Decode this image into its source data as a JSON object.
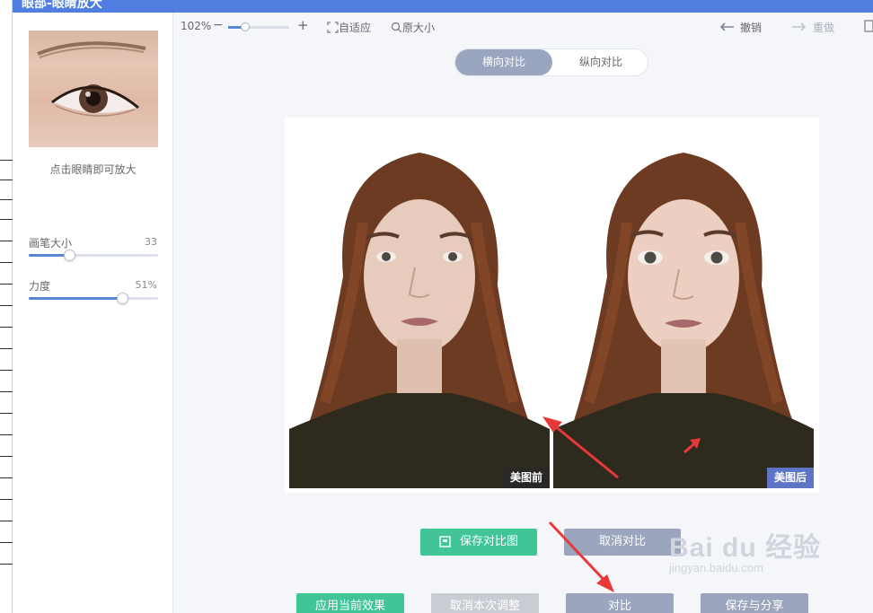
{
  "window": {
    "title": "眼部-眼睛放大"
  },
  "left_panel": {
    "hint": "点击眼睛即可放大",
    "sliders": [
      {
        "label": "画笔大小",
        "value_text": "33",
        "fraction": 0.31
      },
      {
        "label": "力度",
        "value_text": "51%",
        "fraction": 0.72
      }
    ]
  },
  "toolbar": {
    "zoom": "102%",
    "zoom_out": "−",
    "zoom_in": "+",
    "fit": "自适应",
    "original": "原大小",
    "undo": "撤销",
    "redo": "重做"
  },
  "compare_mode": {
    "options": [
      "横向对比",
      "纵向对比"
    ],
    "active": "横向对比"
  },
  "photos": {
    "before_label": "美图前",
    "after_label": "美图后"
  },
  "buttons": {
    "save_compare": "保存对比图",
    "cancel_compare": "取消对比",
    "apply": "应用当前效果",
    "cancel_adjust": "取消本次调整",
    "compare": "对比",
    "save_share": "保存与分享"
  },
  "watermark": {
    "brand": "Bai du 经验",
    "url": "jingyan.baidu.com"
  },
  "colors": {
    "accent": "#4f7ee0",
    "green": "#41c596",
    "grey_button": "#9ba5bd",
    "after_tag": "#5d75c4",
    "arrow": "#e8393a"
  }
}
